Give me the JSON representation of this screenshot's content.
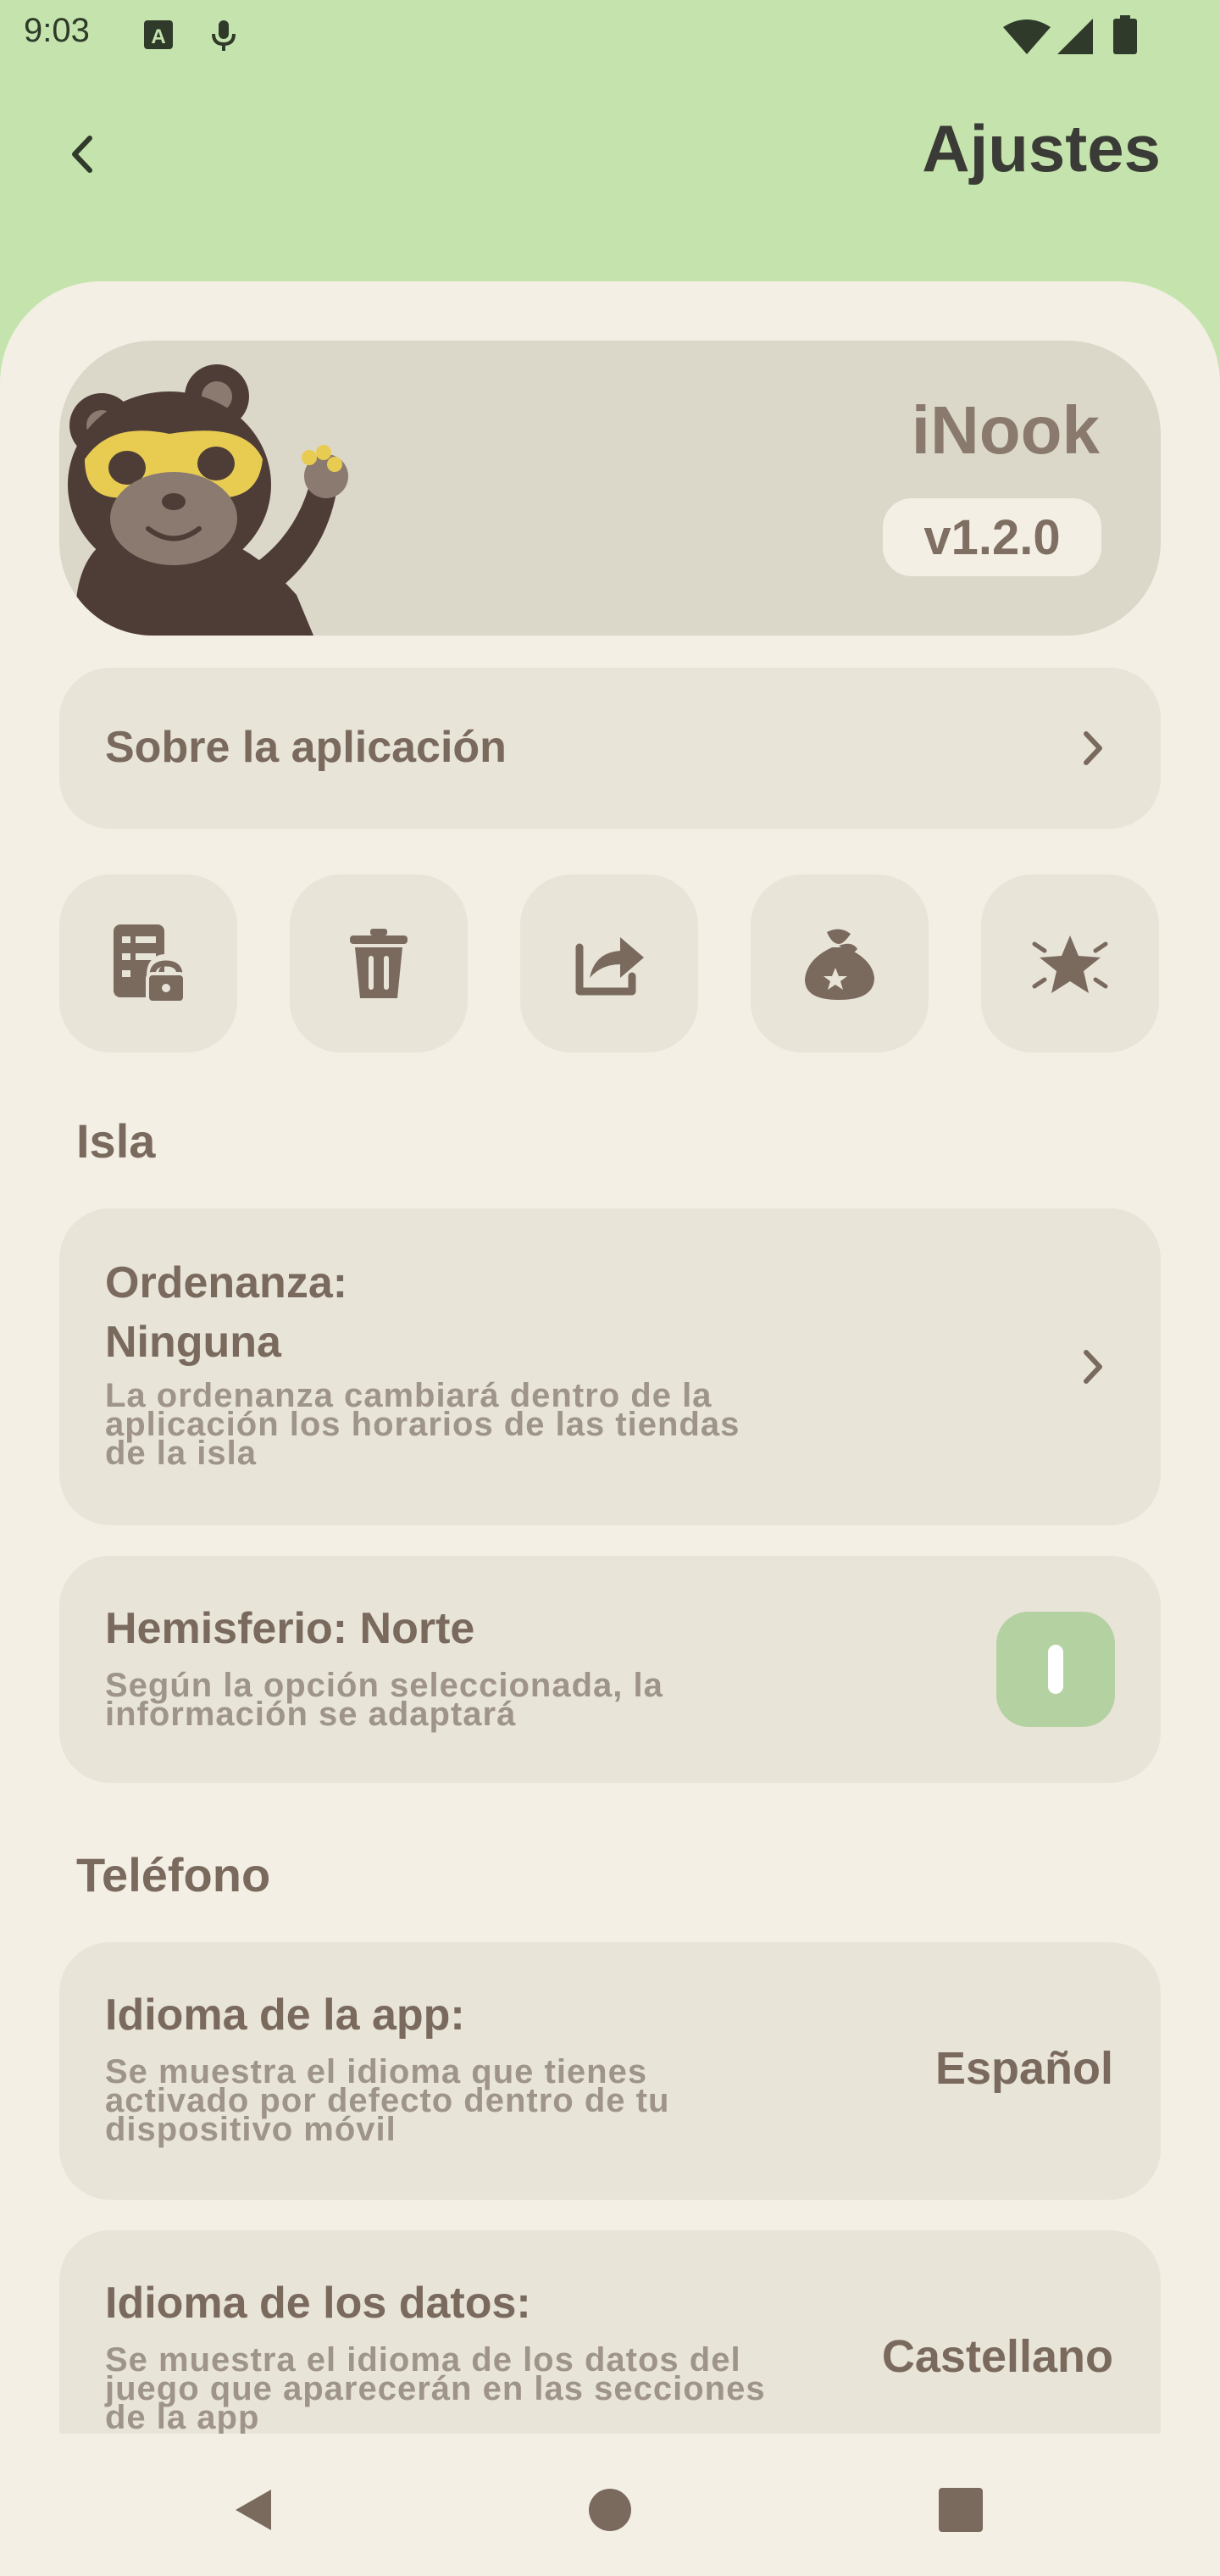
{
  "status_bar": {
    "time": "9:03"
  },
  "header": {
    "title": "Ajustes"
  },
  "hero": {
    "app_name": "iNook",
    "version": "v1.2.0"
  },
  "about": {
    "label": "Sobre la aplicación"
  },
  "quick_actions": [
    {
      "icon": "privacy-lock-icon"
    },
    {
      "icon": "trash-icon"
    },
    {
      "icon": "share-icon"
    },
    {
      "icon": "donate-bag-icon"
    },
    {
      "icon": "rate-star-icon"
    }
  ],
  "island": {
    "section_title": "Isla",
    "ordinance": {
      "title": "Ordenanza:",
      "value": "Ninguna",
      "description": "La ordenanza cambiará dentro de la aplicación los horarios de las tiendas de la isla"
    },
    "hemisphere": {
      "title": "Hemisferio: Norte",
      "description": "Según la opción seleccionada, la información se adaptará"
    }
  },
  "phone": {
    "section_title": "Teléfono",
    "app_language": {
      "title": "Idioma de la app:",
      "description": "Se muestra el idioma que tienes activado por defecto dentro de tu dispositivo móvil",
      "value": "Español"
    },
    "data_language": {
      "title": "Idioma de los datos:",
      "description": "Se muestra el idioma de los datos del juego que aparecerán en las secciones de la app",
      "value": "Castellano"
    }
  },
  "colors": {
    "header_bg": "#c5e4ad",
    "sheet_bg": "#f3efe4",
    "card_bg": "#e8e4d8",
    "accent": "#b4d1a1",
    "text": "#7a6a5e"
  }
}
